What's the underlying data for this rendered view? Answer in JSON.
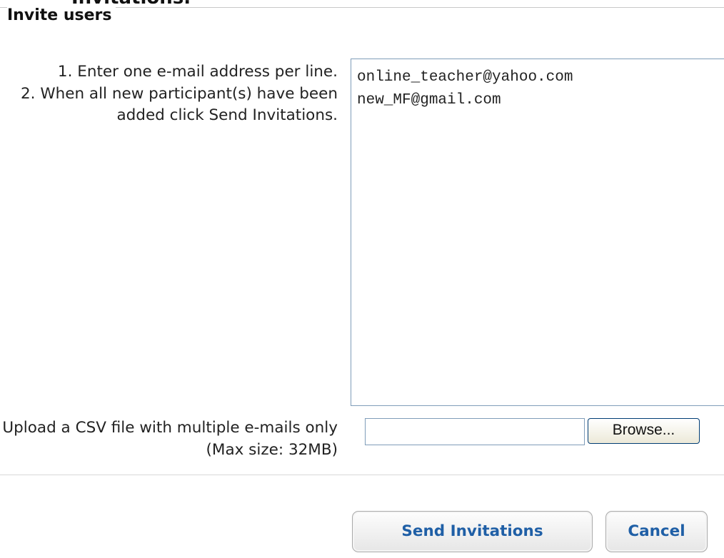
{
  "partial_heading": "Invitations.",
  "section": {
    "legend": "Invite users"
  },
  "instructions": {
    "step1": "1. Enter one e-mail address per line.",
    "step2": "2. When all new participant(s) have been added click Send Invitations."
  },
  "email_list": {
    "value": "online_teacher@yahoo.com\nnew_MF@gmail.com"
  },
  "csv_upload": {
    "label": "Upload a CSV file with multiple e-mails only (Max size: 32MB)",
    "file_value": "",
    "browse_label": "Browse..."
  },
  "actions": {
    "send_label": "Send Invitations",
    "cancel_label": "Cancel"
  },
  "colors": {
    "button_text": "#1f5fa6",
    "input_border": "#7f9db9"
  }
}
